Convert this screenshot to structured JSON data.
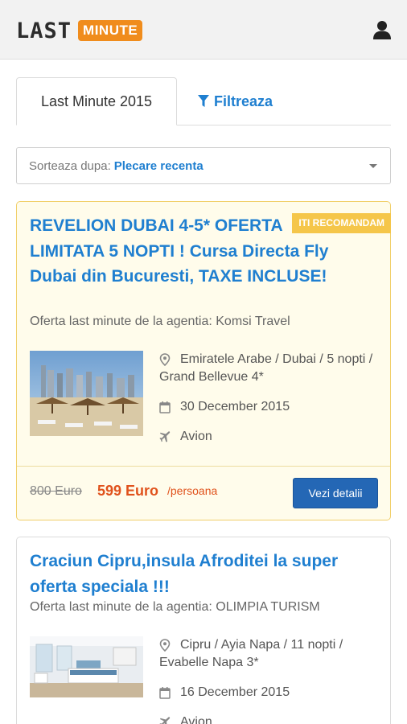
{
  "header": {
    "logo_last": "LAST",
    "logo_minute": "MINUTE",
    "user_icon": "user-icon"
  },
  "tabs": [
    {
      "label": "Last Minute 2015",
      "active": true
    },
    {
      "label": "Filtreaza",
      "icon": "filter-icon",
      "active": false
    }
  ],
  "sort": {
    "label": "Sorteaza dupa:",
    "value": "Plecare recenta"
  },
  "offers": [
    {
      "badge": "ITI RECOMANDAM",
      "title": "REVELION DUBAI 4-5* OFERTA LIMITATA 5 NOPTI ! Cursa Directa Fly Dubai din Bucuresti, TAXE INCLUSE!",
      "agency": "Oferta last minute de la agentia: Komsi Travel",
      "location": "Emiratele Arabe / Dubai / 5 nopti / Grand Bellevue 4*",
      "date": "30 December 2015",
      "transport": "Avion",
      "price_old": "800 Euro",
      "price_new": "599 Euro",
      "price_unit": "/persoana",
      "button": "Vezi detalii"
    },
    {
      "title": "Craciun Cipru,insula Afroditei la super oferta speciala !!!",
      "agency": "Oferta last minute de la agentia: OLIMPIA TURISM",
      "location": "Cipru / Ayia Napa / 11 nopti / Evabelle Napa 3*",
      "date": "16 December 2015",
      "transport": "Avion"
    }
  ],
  "colors": {
    "accent": "#1f7fd0",
    "brand_orange": "#f08c1c",
    "price": "#e0521c",
    "recommended_bg": "#fffceb",
    "badge": "#f5c64a",
    "button": "#2467b5"
  }
}
